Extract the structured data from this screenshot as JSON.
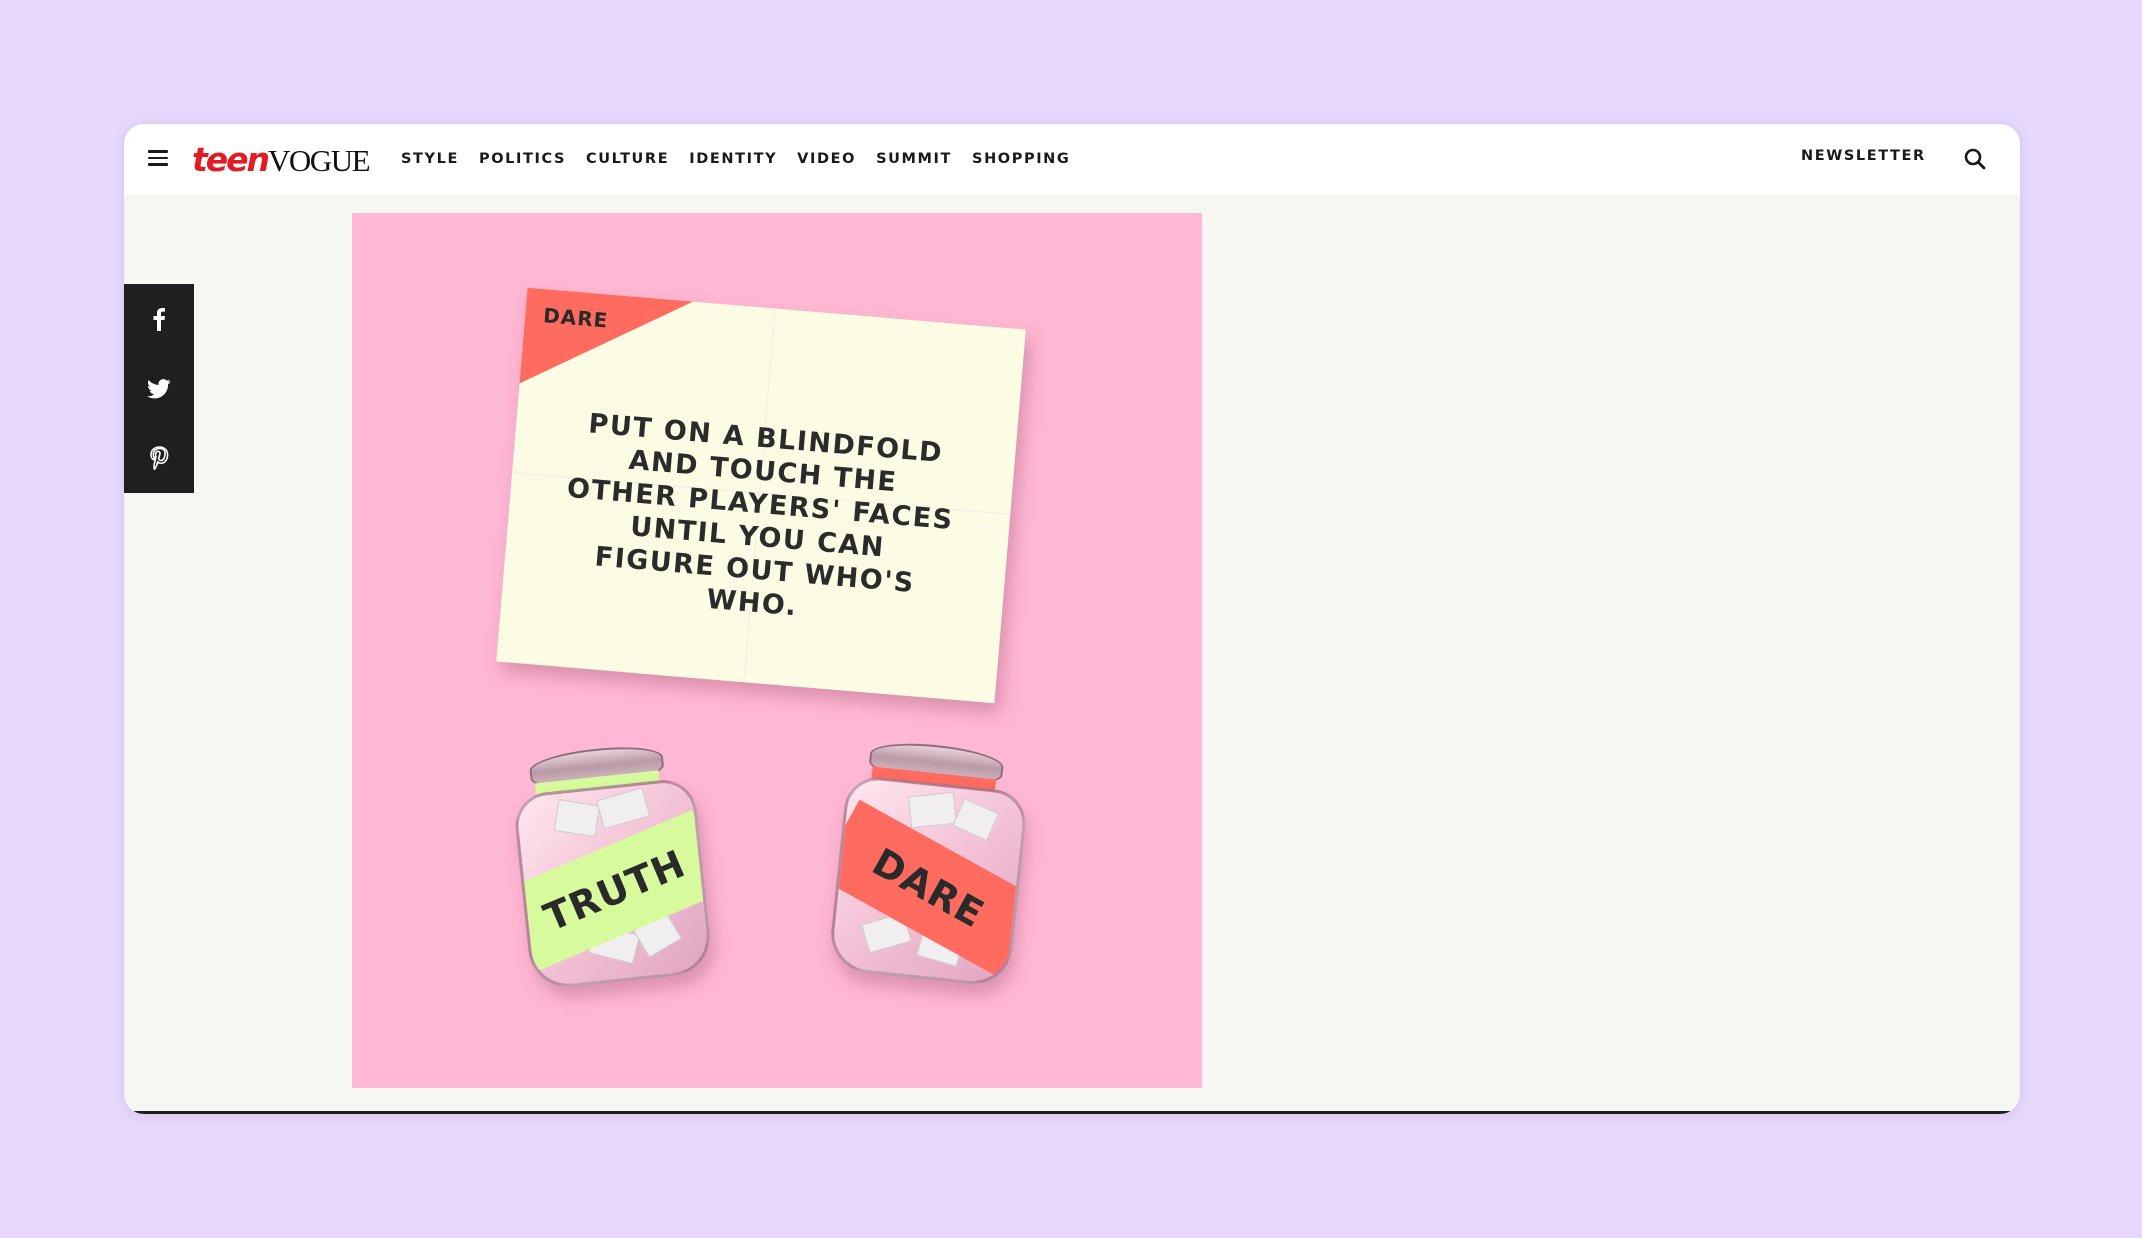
{
  "brand": {
    "teen": "teen",
    "vogue": "VOGUE",
    "teen_color": "#e21b25"
  },
  "nav": {
    "links": [
      "STYLE",
      "POLITICS",
      "CULTURE",
      "IDENTITY",
      "VIDEO",
      "SUMMIT",
      "SHOPPING"
    ],
    "newsletter": "NEWSLETTER"
  },
  "icons": {
    "menu": "hamburger-menu-icon",
    "search": "search-icon",
    "share": [
      "facebook-icon",
      "twitter-icon",
      "pinterest-icon"
    ]
  },
  "hero": {
    "note_flag": "DARE",
    "note_text": "PUT ON A BLINDFOLD\nAND TOUCH THE\nOTHER PLAYERS' FACES\nUNTIL YOU CAN\nFIGURE OUT WHO'S\nWHO.",
    "jar_truth_label": "TRUTH",
    "jar_dare_label": "DARE",
    "colors": {
      "background": "#ffb8d4",
      "note": "#fcfbe3",
      "flag": "#ff6b5f",
      "truth_label": "#d7fa9c",
      "dare_label": "#ff6b5f"
    }
  }
}
